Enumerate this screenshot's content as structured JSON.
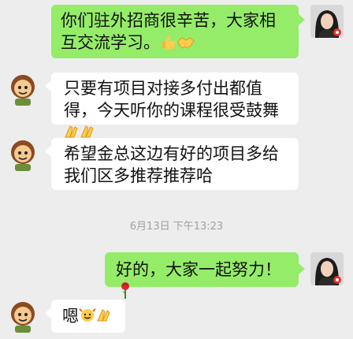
{
  "messages": [
    {
      "id": "m1",
      "side": "out",
      "text": "你们驻外招商很辛苦，大家相互交流学习。",
      "emoji": [
        "thumbs-up",
        "handshake"
      ]
    },
    {
      "id": "m2",
      "side": "in",
      "text": "只要有项目对接多付出都值得，今天听你的课程很受鼓舞",
      "emoji": [
        "clapping-hands",
        "clapping-hands"
      ]
    },
    {
      "id": "m3",
      "side": "in",
      "text": "希望金总这边有好的项目多给我们区多推荐推荐哈",
      "emoji": []
    },
    {
      "id": "m4",
      "side": "out",
      "text": "好的，大家一起努力！",
      "emoji": [
        "rose"
      ]
    },
    {
      "id": "m5",
      "side": "in",
      "text": "嗯",
      "emoji": [
        "cheering-face",
        "clapping-hands"
      ]
    }
  ],
  "timestamp": "6月13日 下午13:23",
  "colors": {
    "outgoing_bubble": "#95ec69",
    "incoming_bubble": "#ffffff",
    "background": "#ededed"
  },
  "avatars": {
    "self": "woman-portrait-avatar",
    "contact": "cartoon-character-avatar"
  }
}
